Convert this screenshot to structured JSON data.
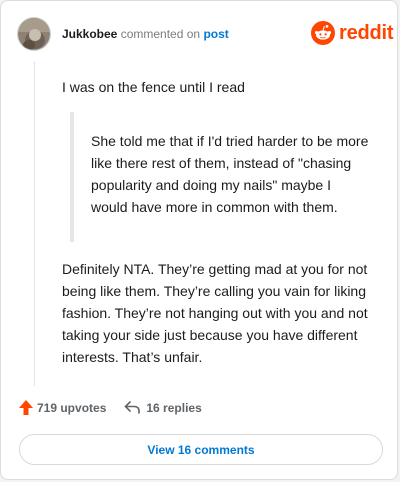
{
  "header": {
    "username": "Jukkobee",
    "action_text": "commented on",
    "post_link": "post"
  },
  "logo": {
    "wordmark": "reddit",
    "icon": "reddit-snoo-icon",
    "color": "#ff4500"
  },
  "comment": {
    "intro": "I was on the fence until I read",
    "quote": "She told me that if I'd tried harder to be more like there rest of them, instead of \"chasing popularity and doing my nails\" maybe I would have more in common with them.",
    "body": "Definitely NTA. They’re getting mad at you for not being like them. They’re calling you vain for liking fashion. They’re not hanging out with you and not taking your side just because you have different interests. That’s unfair."
  },
  "actions": {
    "upvotes": "719 upvotes",
    "upvote_icon": "upvote-arrow-icon",
    "replies": "16 replies",
    "reply_icon": "reply-arrow-icon"
  },
  "view_comments_button": "View 16 comments",
  "colors": {
    "accent": "#ff4500",
    "link": "#0079d3",
    "text": "#1c1c1c",
    "muted": "#7c7c7c"
  }
}
